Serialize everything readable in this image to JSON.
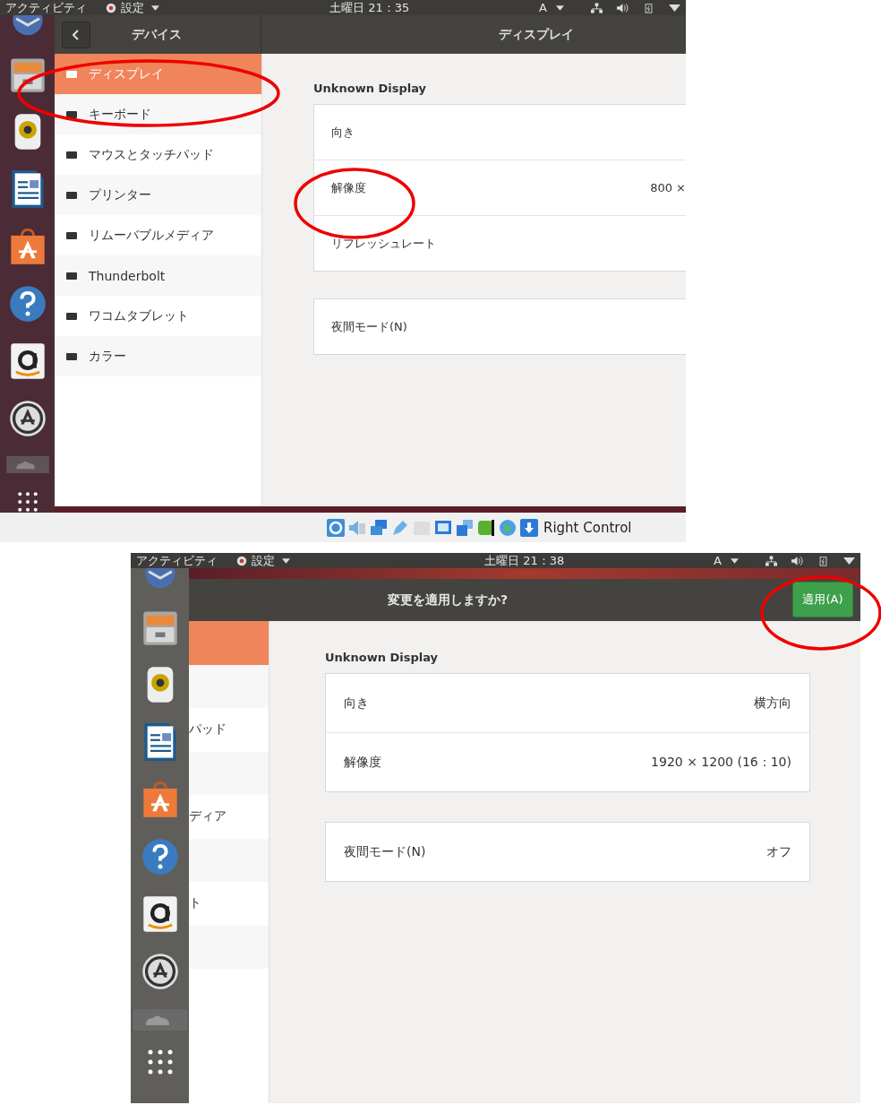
{
  "screens": [
    {
      "top_bar": {
        "activities": "アクティビティ",
        "app_menu": "設定",
        "clock": "土曜日 21：35",
        "input_source": "A"
      },
      "header": {
        "sidebar_title": "デバイス",
        "title": "ディスプレイ"
      },
      "sidebar": [
        {
          "label": "ディスプレイ",
          "selected": true
        },
        {
          "label": "キーボード",
          "selected": false
        },
        {
          "label": "マウスとタッチパッド",
          "selected": false
        },
        {
          "label": "プリンター",
          "selected": false
        },
        {
          "label": "リムーバブルメディア",
          "selected": false
        },
        {
          "label": "Thunderbolt",
          "selected": false
        },
        {
          "label": "ワコムタブレット",
          "selected": false
        },
        {
          "label": "カラー",
          "selected": false
        }
      ],
      "display_name": "Unknown Display",
      "groups": [
        [
          {
            "label": "向き"
          },
          {
            "label": "解像度",
            "value": "800 ×"
          },
          {
            "label": "リフレッシュレート"
          }
        ],
        [
          {
            "label": "夜間モード(N)"
          }
        ]
      ],
      "status_bar": {
        "text": "Right Control"
      }
    },
    {
      "top_bar": {
        "activities": "アクティビティ",
        "app_menu": "設定",
        "clock": "土曜日 21：38",
        "input_source": "A"
      },
      "header": {
        "title": "変更を適用しますか?",
        "apply_button": "適用(A)"
      },
      "sidebar": [
        {
          "selected": true
        },
        {
          "selected": false
        },
        {
          "label": "パッド",
          "selected": false
        },
        {
          "selected": false
        },
        {
          "label": "ディア",
          "selected": false
        },
        {
          "selected": false
        },
        {
          "label": "ト",
          "selected": false
        },
        {
          "selected": false
        }
      ],
      "display_name": "Unknown Display",
      "groups": [
        [
          {
            "label": "向き",
            "value": "横方向"
          },
          {
            "label": "解像度",
            "value": "1920 × 1200 (16：10)"
          }
        ],
        [
          {
            "label": "夜間モード(N)",
            "value": "オフ"
          }
        ]
      ]
    }
  ]
}
